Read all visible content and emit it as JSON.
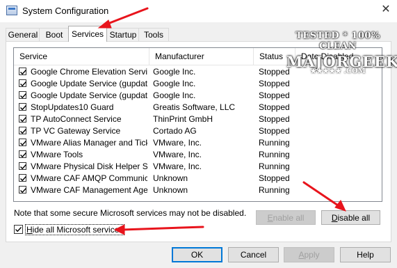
{
  "window": {
    "title": "System Configuration",
    "close_glyph": "✕"
  },
  "tabs": [
    {
      "label": "General",
      "active": false
    },
    {
      "label": "Boot",
      "active": false
    },
    {
      "label": "Services",
      "active": true
    },
    {
      "label": "Startup",
      "active": false
    },
    {
      "label": "Tools",
      "active": false
    }
  ],
  "services": {
    "columns": [
      "Service",
      "Manufacturer",
      "Status",
      "Date Disabled"
    ],
    "rows": [
      {
        "name": "Google Chrome Elevation Service",
        "manufacturer": "Google Inc.",
        "status": "Stopped",
        "checked": true
      },
      {
        "name": "Google Update Service (gupdate)",
        "manufacturer": "Google Inc.",
        "status": "Stopped",
        "checked": true
      },
      {
        "name": "Google Update Service (gupdatem)",
        "manufacturer": "Google Inc.",
        "status": "Stopped",
        "checked": true
      },
      {
        "name": "StopUpdates10 Guard",
        "manufacturer": "Greatis Software, LLC",
        "status": "Stopped",
        "checked": true
      },
      {
        "name": "TP AutoConnect Service",
        "manufacturer": "ThinPrint GmbH",
        "status": "Stopped",
        "checked": true
      },
      {
        "name": "TP VC Gateway Service",
        "manufacturer": "Cortado AG",
        "status": "Stopped",
        "checked": true
      },
      {
        "name": "VMware Alias Manager and Ticke...",
        "manufacturer": "VMware, Inc.",
        "status": "Running",
        "checked": true
      },
      {
        "name": "VMware Tools",
        "manufacturer": "VMware, Inc.",
        "status": "Running",
        "checked": true
      },
      {
        "name": "VMware Physical Disk Helper Ser...",
        "manufacturer": "VMware, Inc.",
        "status": "Running",
        "checked": true
      },
      {
        "name": "VMware CAF AMQP Communicati...",
        "manufacturer": "Unknown",
        "status": "Stopped",
        "checked": true
      },
      {
        "name": "VMware CAF Management Agen...",
        "manufacturer": "Unknown",
        "status": "Running",
        "checked": true
      }
    ]
  },
  "note": "Note that some secure Microsoft services may not be disabled.",
  "buttons": {
    "enable_all": {
      "mnemonic": "E",
      "rest": "nable all",
      "enabled": false
    },
    "disable_all": {
      "mnemonic": "D",
      "rest": "isable all",
      "enabled": true
    },
    "ok": "OK",
    "cancel": "Cancel",
    "apply": {
      "mnemonic": "A",
      "rest": "pply",
      "enabled": false
    },
    "help": "Help"
  },
  "hide_ms": {
    "mnemonic": "H",
    "rest": "ide all Microsoft services",
    "checked": true
  },
  "watermark": {
    "line1": "TESTED * 100% CLEAN",
    "line2": "MAJORGEEKS",
    "line3": "★★★★★ .COM"
  },
  "colors": {
    "arrow": "#e8141c",
    "focus_border": "#0078d7"
  }
}
